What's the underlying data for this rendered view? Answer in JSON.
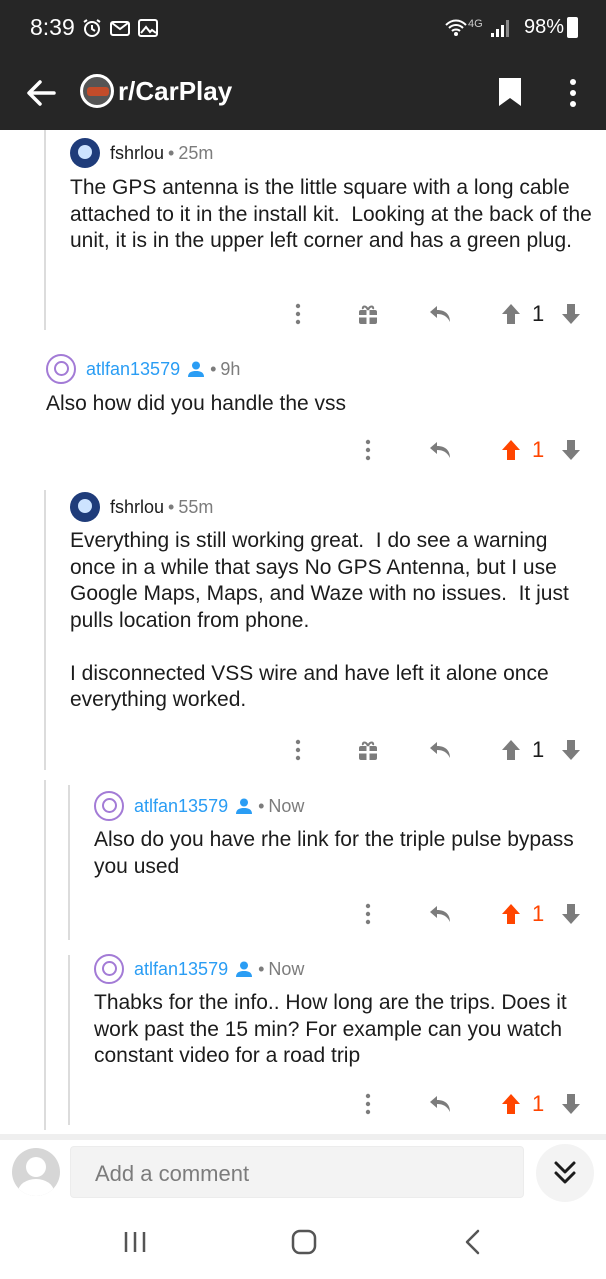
{
  "status_bar": {
    "time": "8:39",
    "network": "4G",
    "battery": "98%"
  },
  "app_bar": {
    "title": "r/CarPlay"
  },
  "comments": [
    {
      "author": "fshrlou",
      "age": "25m",
      "body": "The GPS antenna is the little square with a long cable attached to it in the install kit.  Looking at the back of the unit, it is in the upper left corner and has a green plug.",
      "score": "1",
      "upvoted": false
    },
    {
      "author": "atlfan13579",
      "age": "9h",
      "body": "Also how did you handle the vss",
      "score": "1",
      "upvoted": true
    },
    {
      "author": "fshrlou",
      "age": "55m",
      "body": "Everything is still working great.  I do see a warning once in a while that says No GPS Antenna, but I use Google Maps, Maps, and Waze with no issues.  It just pulls location from phone.\n\nI disconnected VSS wire and have left it alone once everything worked.",
      "score": "1",
      "upvoted": false
    },
    {
      "author": "atlfan13579",
      "age": "Now",
      "body": "Also do you have rhe link for the triple pulse bypass you used",
      "score": "1",
      "upvoted": true
    },
    {
      "author": "atlfan13579",
      "age": "Now",
      "body": "Thabks for the info.. How long are the trips. Does it work past the 15 min? For example can you watch constant video for a road trip",
      "score": "1",
      "upvoted": true
    }
  ],
  "comment_bar": {
    "placeholder": "Add a comment"
  },
  "colors": {
    "upvote": "#ff4500",
    "op_username": "#2a9df4",
    "header": "#262626"
  },
  "icons": {
    "back": "arrow-left-icon",
    "bookmark": "bookmark-icon",
    "more": "more-vertical-icon",
    "award": "gift-icon",
    "reply": "reply-icon",
    "upvote": "arrow-up-icon",
    "downvote": "arrow-down-icon",
    "collapse": "double-chevron-down-icon"
  }
}
